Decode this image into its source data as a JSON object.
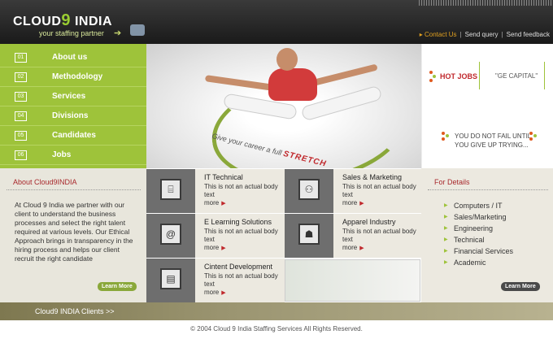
{
  "header": {
    "logo_left": "CLOUD",
    "logo_num": "9",
    "logo_right": " INDIA",
    "tagline": "your staffing partner",
    "links": [
      "Contact Us",
      "Send query",
      "Send feedback"
    ]
  },
  "nav": [
    {
      "num": "01",
      "label": "About us"
    },
    {
      "num": "02",
      "label": "Methodology"
    },
    {
      "num": "03",
      "label": "Services"
    },
    {
      "num": "04",
      "label": "Divisions"
    },
    {
      "num": "05",
      "label": "Candidates"
    },
    {
      "num": "06",
      "label": "Jobs"
    }
  ],
  "hero": {
    "slogan_prefix": "Give your career a full",
    "slogan_emph": "STRETCH"
  },
  "hot_jobs": {
    "label": "HOT JOBS",
    "company": "\"GE CAPITAL\"",
    "quote_line1": "YOU DO NOT FAIL UNTIL",
    "quote_line2": "YOU GIVE UP TRYING..."
  },
  "about": {
    "title": "About Cloud9INDIA",
    "body": "At Cloud 9 India we partner with our client to understand the business processes and select the right talent required at various levels. Our Ethical Approach brings in transparency in the hiring process and helps our client recruit the right candidate",
    "more": "Learn More"
  },
  "services": [
    {
      "title": "IT Technical",
      "body": "This is not an actual body text",
      "more": "more",
      "icon": "desk-icon"
    },
    {
      "title": "Sales & Marketing",
      "body": "This is not an actual body text",
      "more": "more",
      "icon": "people-icon"
    },
    {
      "title": "E Learning Solutions",
      "body": "This is not an actual body text",
      "more": "more",
      "icon": "at-icon"
    },
    {
      "title": "Apparel Industry",
      "body": "This is not an actual body text",
      "more": "more",
      "icon": "shirt-icon"
    },
    {
      "title": "Cintent Development",
      "body": "This is not an actual body text",
      "more": "more",
      "icon": "document-icon"
    }
  ],
  "details": {
    "title": "For Details",
    "items": [
      "Computers / IT",
      "Sales/Marketing",
      "Engineering",
      "Technical",
      "Financial Services",
      "Academic"
    ],
    "more": "Learn More"
  },
  "footer": {
    "clients": "Cloud9 INDIA Clients >>",
    "copyright": "© 2004 Cloud 9 India Staffing Services All Rights Reserved."
  },
  "colors": {
    "accent_green": "#9ec33a",
    "accent_red": "#c0282c",
    "panel_beige": "#ece9e0"
  }
}
